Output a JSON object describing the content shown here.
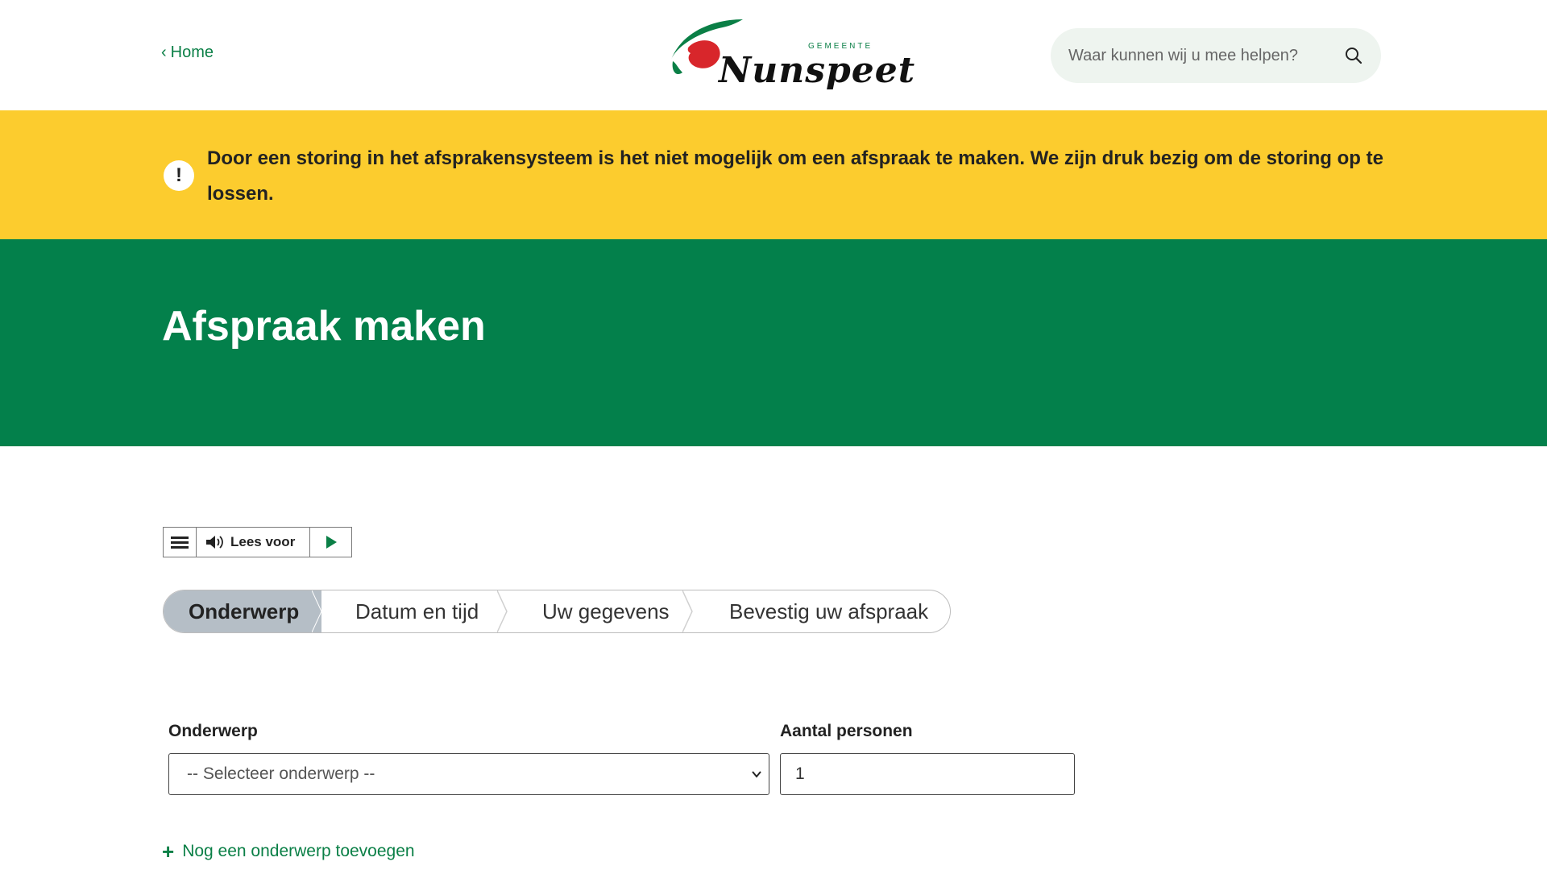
{
  "header": {
    "home_label": "Home",
    "logo_small": "GEMEENTE",
    "logo_text": "Nunspeet",
    "search_placeholder": "Waar kunnen wij u mee helpen?"
  },
  "alert": {
    "message": "Door een storing in het afsprakensysteem is het niet mogelijk om een afspraak te maken. We zijn druk bezig om de storing op te lossen.",
    "icon_symbol": "!"
  },
  "hero": {
    "title": "Afspraak maken"
  },
  "readspeaker": {
    "listen_label": "Lees voor"
  },
  "steps": [
    {
      "label": "Onderwerp",
      "active": true
    },
    {
      "label": "Datum en tijd",
      "active": false
    },
    {
      "label": "Uw gegevens",
      "active": false
    },
    {
      "label": "Bevestig uw afspraak",
      "active": false
    }
  ],
  "form": {
    "subject_label": "Onderwerp",
    "subject_selected": "-- Selecteer onderwerp --",
    "persons_label": "Aantal personen",
    "persons_value": "1",
    "add_subject_label": "Nog een onderwerp toevoegen"
  },
  "colors": {
    "brand_green": "#03804b",
    "alert_yellow": "#fccc2e",
    "active_step": "#b5bec6",
    "logo_red": "#d8262b"
  }
}
